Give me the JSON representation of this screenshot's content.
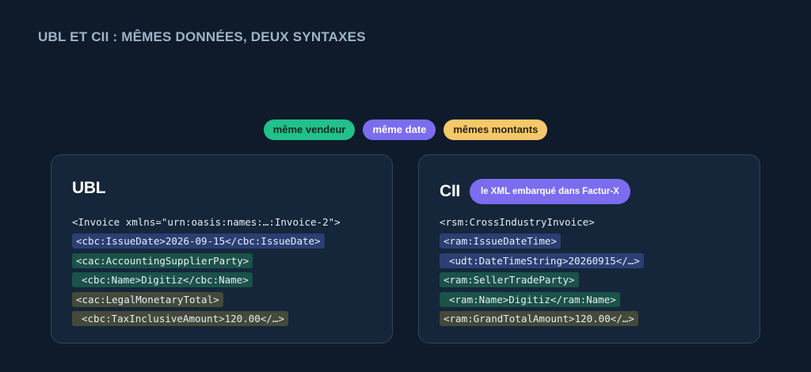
{
  "title": "UBL ET CII : MÊMES DONNÉES, DEUX SYNTAXES",
  "pills": [
    {
      "label": "même vendeur",
      "color": "#22c08a"
    },
    {
      "label": "même date",
      "color": "#7b6cf0"
    },
    {
      "label": "mêmes montants",
      "color": "#f5c86a"
    }
  ],
  "ubl": {
    "title": "UBL",
    "lines": [
      "<Invoice xmlns=\"urn:oasis:names:…:Invoice-2\">",
      "<cbc:IssueDate>2026-09-15</cbc:IssueDate>",
      "<cac:AccountingSupplierParty>",
      "<cbc:Name>Digitiz</cbc:Name>",
      "<cac:LegalMonetaryTotal>",
      "<cbc:TaxInclusiveAmount>120.00</…>"
    ]
  },
  "cii": {
    "title": "CII",
    "tag": "le XML embarqué dans Factur-X",
    "lines": [
      "<rsm:CrossIndustryInvoice>",
      "<ram:IssueDateTime>",
      "<udt:DateTimeString>20260915</…>",
      "<ram:SellerTradeParty>",
      "<ram:Name>Digitiz</ram:Name>",
      "<ram:GrandTotalAmount>120.00</…>"
    ]
  },
  "colors": {
    "date_highlight": "#2b3f73",
    "seller_highlight": "#1b5249",
    "amount_highlight": "#44493a"
  }
}
